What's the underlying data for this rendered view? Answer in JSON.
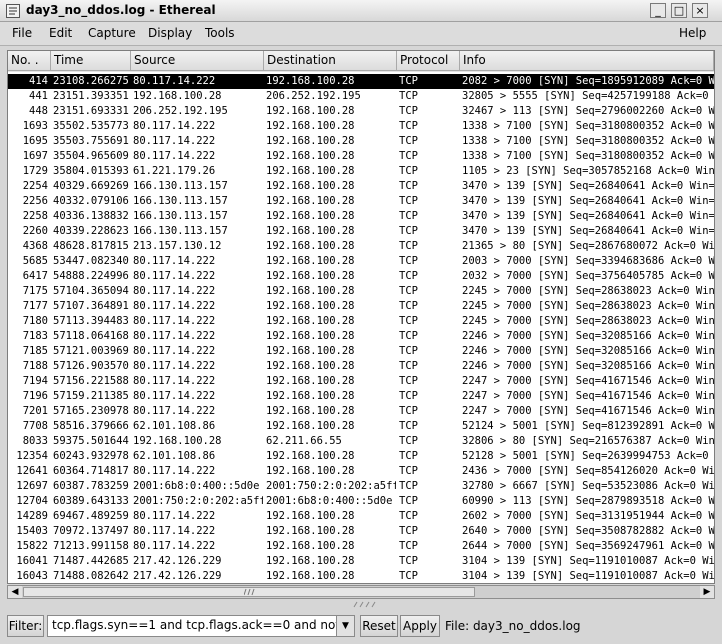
{
  "window": {
    "title": "day3_no_ddos.log - Ethereal",
    "btn_min": "_",
    "btn_max": "□",
    "btn_close": "×"
  },
  "menu": {
    "file": "File",
    "edit": "Edit",
    "capture": "Capture",
    "display": "Display",
    "tools": "Tools",
    "help": "Help"
  },
  "columns": [
    "No. .",
    "Time",
    "Source",
    "Destination",
    "Protocol",
    "Info"
  ],
  "packets": [
    [
      "414",
      "23108.266275",
      "80.117.14.222",
      "192.168.100.28",
      "TCP",
      "2082 > 7000 [SYN] Seq=1895912089 Ack=0 Win"
    ],
    [
      "441",
      "23151.393351",
      "192.168.100.28",
      "206.252.192.195",
      "TCP",
      "32805 > 5555 [SYN] Seq=4257199188 Ack=0 Win"
    ],
    [
      "448",
      "23151.693331",
      "206.252.192.195",
      "192.168.100.28",
      "TCP",
      "32467 > 113 [SYN] Seq=2796002260 Ack=0 Win"
    ],
    [
      "1693",
      "35502.535773",
      "80.117.14.222",
      "192.168.100.28",
      "TCP",
      "1338 > 7100 [SYN] Seq=3180800352 Ack=0 Win="
    ],
    [
      "1695",
      "35503.755691",
      "80.117.14.222",
      "192.168.100.28",
      "TCP",
      "1338 > 7100 [SYN] Seq=3180800352 Ack=0 Win="
    ],
    [
      "1697",
      "35504.965609",
      "80.117.14.222",
      "192.168.100.28",
      "TCP",
      "1338 > 7100 [SYN] Seq=3180800352 Ack=0 Win="
    ],
    [
      "1729",
      "35804.015393",
      "61.221.179.26",
      "192.168.100.28",
      "TCP",
      "1105 > 23 [SYN] Seq=3057852168 Ack=0 Win=3"
    ],
    [
      "2254",
      "40329.669269",
      "166.130.113.157",
      "192.168.100.28",
      "TCP",
      "3470 > 139 [SYN] Seq=26840641 Ack=0 Win=81"
    ],
    [
      "2256",
      "40332.079106",
      "166.130.113.157",
      "192.168.100.28",
      "TCP",
      "3470 > 139 [SYN] Seq=26840641 Ack=0 Win=81"
    ],
    [
      "2258",
      "40336.138832",
      "166.130.113.157",
      "192.168.100.28",
      "TCP",
      "3470 > 139 [SYN] Seq=26840641 Ack=0 Win=81"
    ],
    [
      "2260",
      "40339.228623",
      "166.130.113.157",
      "192.168.100.28",
      "TCP",
      "3470 > 139 [SYN] Seq=26840641 Ack=0 Win=81"
    ],
    [
      "4368",
      "48628.817815",
      "213.157.130.12",
      "192.168.100.28",
      "TCP",
      "21365 > 80 [SYN] Seq=2867680072 Ack=0 Win"
    ],
    [
      "5685",
      "53447.082340",
      "80.117.14.222",
      "192.168.100.28",
      "TCP",
      "2003 > 7000 [SYN] Seq=3394683686 Ack=0 Win"
    ],
    [
      "6417",
      "54888.224996",
      "80.117.14.222",
      "192.168.100.28",
      "TCP",
      "2032 > 7000 [SYN] Seq=3756405785 Ack=0 Win"
    ],
    [
      "7175",
      "57104.365094",
      "80.117.14.222",
      "192.168.100.28",
      "TCP",
      "2245 > 7000 [SYN] Seq=28638023 Ack=0 Win=1"
    ],
    [
      "7177",
      "57107.364891",
      "80.117.14.222",
      "192.168.100.28",
      "TCP",
      "2245 > 7000 [SYN] Seq=28638023 Ack=0 Win=1"
    ],
    [
      "7180",
      "57113.394483",
      "80.117.14.222",
      "192.168.100.28",
      "TCP",
      "2245 > 7000 [SYN] Seq=28638023 Ack=0 Win=1"
    ],
    [
      "7183",
      "57118.064168",
      "80.117.14.222",
      "192.168.100.28",
      "TCP",
      "2246 > 7000 [SYN] Seq=32085166 Ack=0 Win=1"
    ],
    [
      "7185",
      "57121.003969",
      "80.117.14.222",
      "192.168.100.28",
      "TCP",
      "2246 > 7000 [SYN] Seq=32085166 Ack=0 Win=1"
    ],
    [
      "7188",
      "57126.903570",
      "80.117.14.222",
      "192.168.100.28",
      "TCP",
      "2246 > 7000 [SYN] Seq=32085166 Ack=0 Win=1"
    ],
    [
      "7194",
      "57156.221588",
      "80.117.14.222",
      "192.168.100.28",
      "TCP",
      "2247 > 7000 [SYN] Seq=41671546 Ack=0 Win=1"
    ],
    [
      "7196",
      "57159.211385",
      "80.117.14.222",
      "192.168.100.28",
      "TCP",
      "2247 > 7000 [SYN] Seq=41671546 Ack=0 Win=1"
    ],
    [
      "7201",
      "57165.230978",
      "80.117.14.222",
      "192.168.100.28",
      "TCP",
      "2247 > 7000 [SYN] Seq=41671546 Ack=0 Win=1"
    ],
    [
      "7708",
      "58516.379666",
      "62.101.108.86",
      "192.168.100.28",
      "TCP",
      "52124 > 5001 [SYN] Seq=812392891 Ack=0 Win"
    ],
    [
      "8033",
      "59375.501644",
      "192.168.100.28",
      "62.211.66.55",
      "TCP",
      "32806 > 80 [SYN] Seq=216576387 Ack=0 Win=2"
    ],
    [
      "12354",
      "60243.932978",
      "62.101.108.86",
      "192.168.100.28",
      "TCP",
      "52128 > 5001 [SYN] Seq=2639994753 Ack=0 Wi"
    ],
    [
      "12641",
      "60364.714817",
      "80.117.14.222",
      "192.168.100.28",
      "TCP",
      "2436 > 7000 [SYN] Seq=854126020 Ack=0 Win="
    ],
    [
      "12697",
      "60387.783259",
      "2001:6b8:0:400::5d0e",
      "2001:750:2:0:202:a5ff",
      "TCP",
      "32780 > 6667 [SYN] Seq=53523086 Ack=0 Win"
    ],
    [
      "12704",
      "60389.643133",
      "2001:750:2:0:202:a5ff",
      "2001:6b8:0:400::5d0e",
      "TCP",
      "60990 > 113 [SYN] Seq=2879893518 Ack=0 Win"
    ],
    [
      "14289",
      "69467.489259",
      "80.117.14.222",
      "192.168.100.28",
      "TCP",
      "2602 > 7000 [SYN] Seq=3131951944 Ack=0 Win"
    ],
    [
      "15403",
      "70972.137497",
      "80.117.14.222",
      "192.168.100.28",
      "TCP",
      "2640 > 7000 [SYN] Seq=3508782882 Ack=0 Win"
    ],
    [
      "15822",
      "71213.991158",
      "80.117.14.222",
      "192.168.100.28",
      "TCP",
      "2644 > 7000 [SYN] Seq=3569247961 Ack=0 Win"
    ],
    [
      "16041",
      "71487.442685",
      "217.42.126.229",
      "192.168.100.28",
      "TCP",
      "3104 > 139 [SYN] Seq=1191010087 Ack=0 Win"
    ],
    [
      "16043",
      "71488.082642",
      "217.42.126.229",
      "192.168.100.28",
      "TCP",
      "3104 > 139 [SYN] Seq=1191010087 Ack=0 Win"
    ]
  ],
  "selected_no": "414",
  "filter": {
    "label": "Filter:",
    "value": "tcp.flags.syn==1 and tcp.flags.ack==0 and not icmp",
    "reset": "Reset",
    "apply": "Apply"
  },
  "status": {
    "file_text": "File: day3_no_ddos.log"
  }
}
